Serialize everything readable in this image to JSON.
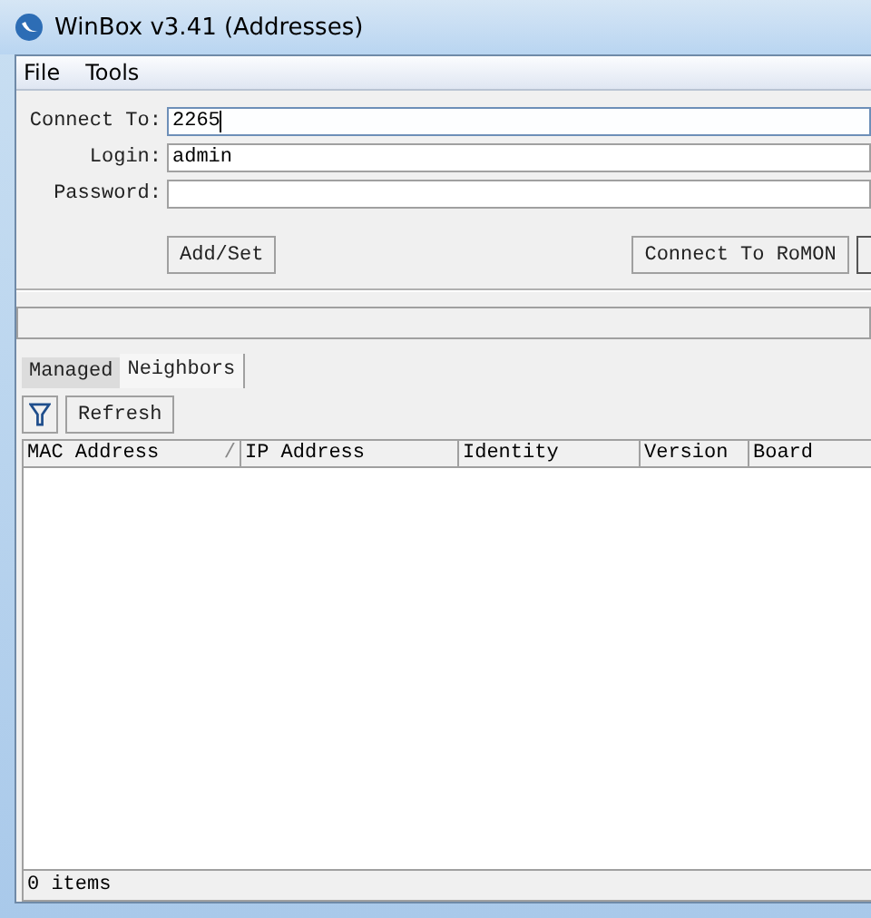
{
  "window": {
    "title": "WinBox v3.41 (Addresses)"
  },
  "menu": [
    {
      "label": "File"
    },
    {
      "label": "Tools"
    }
  ],
  "form": {
    "fields": [
      {
        "label": "Connect To:",
        "value": "2265",
        "focused": true
      },
      {
        "label": "Login:",
        "value": "admin",
        "focused": false
      },
      {
        "label": "Password:",
        "focused": false
      }
    ],
    "add_button": "Add/Set",
    "romon_button": "Connect To RoMON"
  },
  "tabs": [
    {
      "label": "Managed",
      "selected": false
    },
    {
      "label": "Neighbors",
      "selected": true
    }
  ],
  "toolbar": {
    "refresh": "Refresh"
  },
  "table": {
    "columns": [
      {
        "label": "MAC Address",
        "sort_mark": "/"
      },
      {
        "label": "IP Address"
      },
      {
        "label": "Identity"
      },
      {
        "label": "Version"
      },
      {
        "label": "Board"
      }
    ]
  },
  "status_bar": "0 items"
}
